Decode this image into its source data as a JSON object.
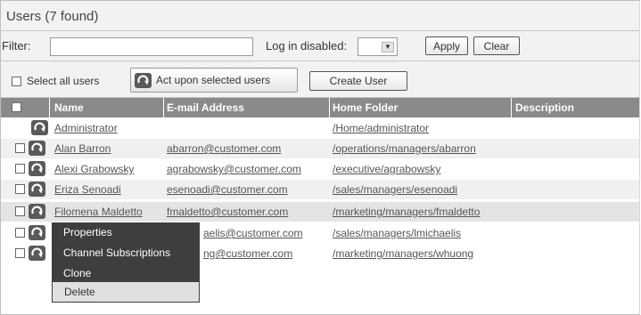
{
  "title": "Users (7 found)",
  "filter": {
    "label": "Filter:",
    "value": "",
    "login_disabled_label": "Log in disabled:",
    "login_disabled_value": "",
    "apply_label": "Apply",
    "clear_label": "Clear"
  },
  "actions": {
    "select_all_label": "Select all users",
    "act_upon_label": "Act upon selected users",
    "create_user_label": "Create User"
  },
  "table": {
    "columns": [
      "Name",
      "E-mail Address",
      "Home Folder",
      "Description"
    ],
    "rows": [
      {
        "name": "Administrator",
        "email": "",
        "folder": "/Home/administrator",
        "description": "",
        "checkbox": false
      },
      {
        "name": "Alan Barron",
        "email": "abarron@customer.com",
        "folder": "/operations/managers/abarron",
        "description": "",
        "checkbox": true
      },
      {
        "name": "Alexi Grabowsky",
        "email": "agrabowsky@customer.com",
        "folder": "/executive/agrabowsky",
        "description": "",
        "checkbox": true
      },
      {
        "name": "Eriza Senoadi",
        "email": "esenoadi@customer.com",
        "folder": "/sales/managers/esenoadi",
        "description": "",
        "checkbox": true
      },
      {
        "name": "Filomena Maldetto",
        "email": "fmaldetto@customer.com",
        "folder": "/marketing/managers/fmaldetto",
        "description": "",
        "checkbox": true
      },
      {
        "name": "",
        "email": "aelis@customer.com",
        "folder": "/sales/managers/lmichaelis",
        "description": "",
        "checkbox": true
      },
      {
        "name": "",
        "email": "ng@customer.com",
        "folder": "/marketing/managers/whuong",
        "description": "",
        "checkbox": true
      }
    ]
  },
  "context_menu": {
    "items": [
      "Properties",
      "Channel Subscriptions",
      "Clone",
      "Delete"
    ],
    "selected": "Delete"
  },
  "colors": {
    "header_bg": "#8a8a8a",
    "toolbar_bg": "#f2f2f2",
    "menu_bg": "#3e3e3e"
  },
  "icons": {
    "row_action": "refresh-arrow-icon",
    "select_arrow": "chevron-down-icon"
  }
}
